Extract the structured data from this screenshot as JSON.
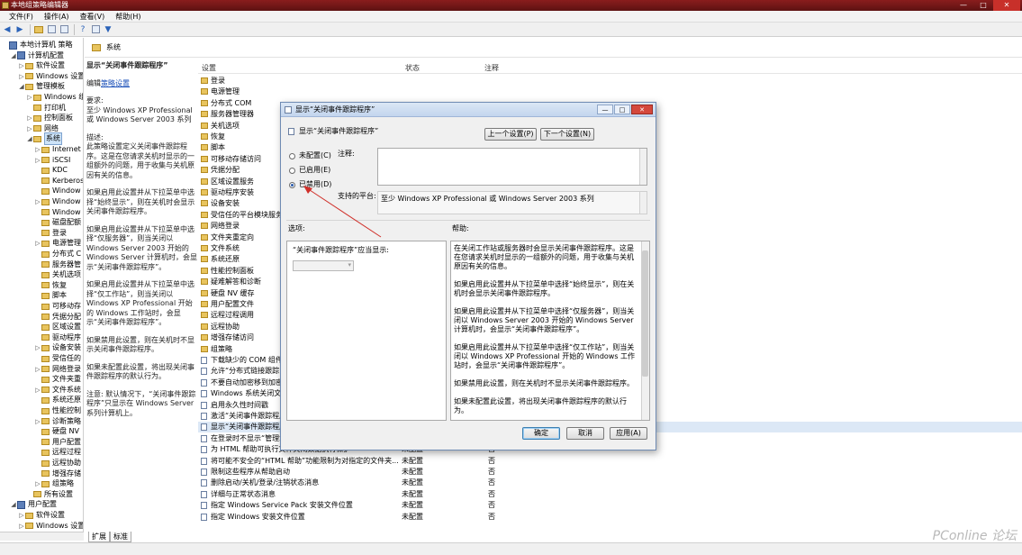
{
  "window": {
    "title": "本地组策略编辑器",
    "minimize": "—",
    "maximize": "□",
    "close": "✕"
  },
  "menu": [
    "文件(F)",
    "操作(A)",
    "查看(V)",
    "帮助(H)"
  ],
  "tree": {
    "items": [
      {
        "label": "本地计算机 策略",
        "indent": 0,
        "icon": "policy",
        "exp": ""
      },
      {
        "label": "计算机配置",
        "indent": 1,
        "icon": "policy",
        "exp": "◢"
      },
      {
        "label": "软件设置",
        "indent": 2,
        "icon": "folder",
        "exp": "▷"
      },
      {
        "label": "Windows 设置",
        "indent": 2,
        "icon": "folder",
        "exp": "▷"
      },
      {
        "label": "管理模板",
        "indent": 2,
        "icon": "folder",
        "exp": "◢"
      },
      {
        "label": "Windows 组",
        "indent": 3,
        "icon": "folder",
        "exp": "▷"
      },
      {
        "label": "打印机",
        "indent": 3,
        "icon": "folder",
        "exp": ""
      },
      {
        "label": "控制面板",
        "indent": 3,
        "icon": "folder",
        "exp": "▷"
      },
      {
        "label": "网络",
        "indent": 3,
        "icon": "folder",
        "exp": "▷"
      },
      {
        "label": "系统",
        "indent": 3,
        "icon": "folder",
        "exp": "◢",
        "selected": true
      },
      {
        "label": "Internet",
        "indent": 4,
        "icon": "folder",
        "exp": "▷"
      },
      {
        "label": "iSCSI",
        "indent": 4,
        "icon": "folder",
        "exp": "▷"
      },
      {
        "label": "KDC",
        "indent": 4,
        "icon": "folder",
        "exp": ""
      },
      {
        "label": "Kerberos",
        "indent": 4,
        "icon": "folder",
        "exp": ""
      },
      {
        "label": "Window",
        "indent": 4,
        "icon": "folder",
        "exp": ""
      },
      {
        "label": "Window",
        "indent": 4,
        "icon": "folder",
        "exp": "▷"
      },
      {
        "label": "Window",
        "indent": 4,
        "icon": "folder",
        "exp": ""
      },
      {
        "label": "磁盘配额",
        "indent": 4,
        "icon": "folder",
        "exp": ""
      },
      {
        "label": "登录",
        "indent": 4,
        "icon": "folder",
        "exp": ""
      },
      {
        "label": "电源管理",
        "indent": 4,
        "icon": "folder",
        "exp": "▷"
      },
      {
        "label": "分布式 C",
        "indent": 4,
        "icon": "folder",
        "exp": ""
      },
      {
        "label": "服务器管",
        "indent": 4,
        "icon": "folder",
        "exp": ""
      },
      {
        "label": "关机选项",
        "indent": 4,
        "icon": "folder",
        "exp": ""
      },
      {
        "label": "恢复",
        "indent": 4,
        "icon": "folder",
        "exp": ""
      },
      {
        "label": "脚本",
        "indent": 4,
        "icon": "folder",
        "exp": ""
      },
      {
        "label": "可移动存",
        "indent": 4,
        "icon": "folder",
        "exp": ""
      },
      {
        "label": "凭据分配",
        "indent": 4,
        "icon": "folder",
        "exp": ""
      },
      {
        "label": "区域设置",
        "indent": 4,
        "icon": "folder",
        "exp": ""
      },
      {
        "label": "驱动程序",
        "indent": 4,
        "icon": "folder",
        "exp": ""
      },
      {
        "label": "设备安装",
        "indent": 4,
        "icon": "folder",
        "exp": "▷"
      },
      {
        "label": "受信任的",
        "indent": 4,
        "icon": "folder",
        "exp": ""
      },
      {
        "label": "网络登录",
        "indent": 4,
        "icon": "folder",
        "exp": "▷"
      },
      {
        "label": "文件夹重",
        "indent": 4,
        "icon": "folder",
        "exp": ""
      },
      {
        "label": "文件系统",
        "indent": 4,
        "icon": "folder",
        "exp": "▷"
      },
      {
        "label": "系统还原",
        "indent": 4,
        "icon": "folder",
        "exp": ""
      },
      {
        "label": "性能控制",
        "indent": 4,
        "icon": "folder",
        "exp": ""
      },
      {
        "label": "诊断策略",
        "indent": 4,
        "icon": "folder",
        "exp": "▷"
      },
      {
        "label": "硬盘 NV",
        "indent": 4,
        "icon": "folder",
        "exp": ""
      },
      {
        "label": "用户配置",
        "indent": 4,
        "icon": "folder",
        "exp": ""
      },
      {
        "label": "远程过程",
        "indent": 4,
        "icon": "folder",
        "exp": ""
      },
      {
        "label": "远程协助",
        "indent": 4,
        "icon": "folder",
        "exp": ""
      },
      {
        "label": "增强存储",
        "indent": 4,
        "icon": "folder",
        "exp": ""
      },
      {
        "label": "组策略",
        "indent": 4,
        "icon": "folder",
        "exp": "▷"
      },
      {
        "label": "所有设置",
        "indent": 3,
        "icon": "folder",
        "exp": ""
      },
      {
        "label": "用户配置",
        "indent": 1,
        "icon": "policy",
        "exp": "◢"
      },
      {
        "label": "软件设置",
        "indent": 2,
        "icon": "folder",
        "exp": "▷"
      },
      {
        "label": "Windows 设置",
        "indent": 2,
        "icon": "folder",
        "exp": "▷"
      }
    ]
  },
  "path": {
    "label": "系统"
  },
  "description": {
    "title": "显示“关闭事件跟踪程序”",
    "edit_prefix": "编辑",
    "edit_link": "策略设置",
    "requirements_label": "要求:",
    "requirements": "至少 Windows XP Professional 或 Windows Server 2003 系列",
    "desc_label": "描述:",
    "paragraphs": [
      "此策略设置定义关闭事件跟踪程序。这是在您请求关机时显示的一组额外的问题，用于收集与关机原因有关的信息。",
      "如果启用此设置并从下拉菜单中选择“始终显示”，则在关机时会显示关闭事件跟踪程序。",
      "如果启用此设置并从下拉菜单中选择“仅服务器”，则当关闭以 Windows Server 2003 开始的 Windows Server 计算机时，会显示“关闭事件跟踪程序”。",
      "如果启用此设置并从下拉菜单中选择“仅工作站”，则当关闭以 Windows XP Professional 开始的 Windows 工作站时，会显示“关闭事件跟踪程序”。",
      "如果禁用此设置，则在关机时不显示关闭事件跟踪程序。",
      "如果未配置此设置，将出现关闭事件跟踪程序的默认行为。",
      "注意: 默认情况下，“关闭事件跟踪程序”只显示在 Windows Server 系列计算机上。"
    ]
  },
  "list": {
    "headers": {
      "setting": "设置",
      "state": "状态",
      "comment": "注释"
    },
    "rows": [
      {
        "name": "登录",
        "icon": "folder",
        "state": "",
        "comment": ""
      },
      {
        "name": "电源管理",
        "icon": "folder",
        "state": "",
        "comment": ""
      },
      {
        "name": "分布式 COM",
        "icon": "folder",
        "state": "",
        "comment": ""
      },
      {
        "name": "服务器管理器",
        "icon": "folder",
        "state": "",
        "comment": ""
      },
      {
        "name": "关机选项",
        "icon": "folder",
        "state": "",
        "comment": ""
      },
      {
        "name": "恢复",
        "icon": "folder",
        "state": "",
        "comment": ""
      },
      {
        "name": "脚本",
        "icon": "folder",
        "state": "",
        "comment": ""
      },
      {
        "name": "可移动存储访问",
        "icon": "folder",
        "state": "",
        "comment": ""
      },
      {
        "name": "凭据分配",
        "icon": "folder",
        "state": "",
        "comment": ""
      },
      {
        "name": "区域设置服务",
        "icon": "folder",
        "state": "",
        "comment": ""
      },
      {
        "name": "驱动程序安装",
        "icon": "folder",
        "state": "",
        "comment": ""
      },
      {
        "name": "设备安装",
        "icon": "folder",
        "state": "",
        "comment": ""
      },
      {
        "name": "受信任的平台模块服务",
        "icon": "folder",
        "state": "",
        "comment": ""
      },
      {
        "name": "网络登录",
        "icon": "folder",
        "state": "",
        "comment": ""
      },
      {
        "name": "文件夹重定向",
        "icon": "folder",
        "state": "",
        "comment": ""
      },
      {
        "name": "文件系统",
        "icon": "folder",
        "state": "",
        "comment": ""
      },
      {
        "name": "系统还原",
        "icon": "folder",
        "state": "",
        "comment": ""
      },
      {
        "name": "性能控制面板",
        "icon": "folder",
        "state": "",
        "comment": ""
      },
      {
        "name": "疑难解答和诊断",
        "icon": "folder",
        "state": "",
        "comment": ""
      },
      {
        "name": "硬盘 NV 缓存",
        "icon": "folder",
        "state": "",
        "comment": ""
      },
      {
        "name": "用户配置文件",
        "icon": "folder",
        "state": "",
        "comment": ""
      },
      {
        "name": "远程过程调用",
        "icon": "folder",
        "state": "",
        "comment": ""
      },
      {
        "name": "远程协助",
        "icon": "folder",
        "state": "",
        "comment": ""
      },
      {
        "name": "增强存储访问",
        "icon": "folder",
        "state": "",
        "comment": ""
      },
      {
        "name": "组策略",
        "icon": "folder",
        "state": "",
        "comment": ""
      },
      {
        "name": "下载缺少的 COM 组件",
        "icon": "policy",
        "state": "",
        "comment": ""
      },
      {
        "name": "允许“分布式链接跟踪”",
        "icon": "policy",
        "state": "",
        "comment": ""
      },
      {
        "name": "不要自动加密移到加密文件",
        "icon": "policy",
        "state": "",
        "comment": ""
      },
      {
        "name": "Windows 系统关闭文件",
        "icon": "policy",
        "state": "",
        "comment": ""
      },
      {
        "name": "启用永久性时间戳",
        "icon": "policy",
        "state": "",
        "comment": ""
      },
      {
        "name": "激活“关闭事件跟踪程序”",
        "icon": "policy",
        "state": "",
        "comment": ""
      },
      {
        "name": "显示“关闭事件跟踪程序”",
        "icon": "policy",
        "state": "",
        "comment": "",
        "highlight": true
      },
      {
        "name": "在登录时不显示“管理您的”",
        "icon": "policy",
        "state": "",
        "comment": ""
      },
      {
        "name": "为 HTML 帮助可执行文件关闭数据执行保护",
        "icon": "policy",
        "state": "未配置",
        "comment": "否"
      },
      {
        "name": "将可能不安全的“HTML 帮助”功能限制为对指定的文件夹...",
        "icon": "policy",
        "state": "未配置",
        "comment": "否"
      },
      {
        "name": "限制这些程序从帮助启动",
        "icon": "policy",
        "state": "未配置",
        "comment": "否"
      },
      {
        "name": "删除启动/关机/登录/注销状态消息",
        "icon": "policy",
        "state": "未配置",
        "comment": "否"
      },
      {
        "name": "详细与正常状态消息",
        "icon": "policy",
        "state": "未配置",
        "comment": "否"
      },
      {
        "name": "指定 Windows Service Pack 安装文件位置",
        "icon": "policy",
        "state": "未配置",
        "comment": "否"
      },
      {
        "name": "指定 Windows 安装文件位置",
        "icon": "policy",
        "state": "未配置",
        "comment": "否"
      }
    ]
  },
  "tabs": [
    "扩展",
    "标准"
  ],
  "dialog": {
    "title": "显示“关闭事件跟踪程序”",
    "setting_name": "显示“关闭事件跟踪程序”",
    "prev_button": "上一个设置(P)",
    "next_button": "下一个设置(N)",
    "radio": [
      {
        "label": "未配置(C)",
        "checked": false
      },
      {
        "label": "已启用(E)",
        "checked": false
      },
      {
        "label": "已禁用(D)",
        "checked": true
      }
    ],
    "comment_label": "注释:",
    "supported_label": "支持的平台:",
    "supported_value": "至少 Windows XP Professional 或 Windows Server 2003 系列",
    "options_label": "选项:",
    "help_label": "帮助:",
    "option_text": "“关闭事件跟踪程序”应当显示:",
    "help_paragraphs": [
      "在关闭工作站或服务器时会显示关闭事件跟踪程序。这是在您请求关机时显示的一组额外的问题，用于收集与关机原因有关的信息。",
      "如果启用此设置并从下拉菜单中选择“始终显示”，则在关机时会显示关闭事件跟踪程序。",
      "如果启用此设置并从下拉菜单中选择“仅服务器”，则当关闭以 Windows Server 2003 开始的 Windows Server 计算机时，会显示“关闭事件跟踪程序”。",
      "如果启用此设置并从下拉菜单中选择“仅工作站”，则当关闭以 Windows XP Professional 开始的 Windows 工作站时，会显示“关闭事件跟踪程序”。",
      "如果禁用此设置，则在关机时不显示关闭事件跟踪程序。",
      "如果未配置此设置，将出现关闭事件跟踪程序的默认行为。",
      "注意: 默认情况下，“关闭事件跟踪程序”只显示在 Windows"
    ],
    "ok_button": "确定",
    "cancel_button": "取消",
    "apply_button": "应用(A)"
  },
  "watermark": "PConline 论坛",
  "colors": {
    "titlebar": "#8a1d1d",
    "selection": "#cde3f8",
    "annotation_arrow": "#d0302a"
  }
}
